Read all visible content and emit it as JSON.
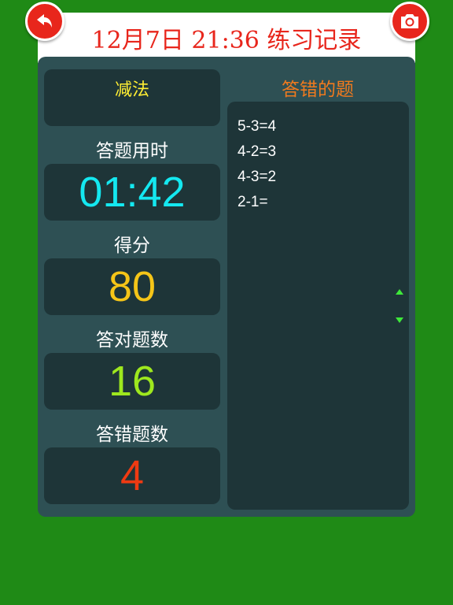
{
  "header": {
    "title": "12月7日 21:36 练习记录",
    "back_icon": "undo-arrow-icon",
    "camera_icon": "camera-icon",
    "accent_color": "#e8261c"
  },
  "mode": {
    "label": "减法"
  },
  "stats": {
    "time_label": "答题用时",
    "time_value": "01:42",
    "score_label": "得分",
    "score_value": "80",
    "correct_label": "答对题数",
    "correct_value": "16",
    "wrong_label": "答错题数",
    "wrong_value": "4"
  },
  "colors": {
    "time": "#14e8f0",
    "score": "#f5c518",
    "correct": "#9ee81e",
    "wrong": "#ef3a12",
    "background": "#1f8a16",
    "panel": "#2e5054",
    "box": "#1e3538"
  },
  "wrong_questions": {
    "title": "答错的题",
    "items": [
      "5-3=4",
      "4-2=3",
      "4-3=2",
      "2-1="
    ]
  }
}
